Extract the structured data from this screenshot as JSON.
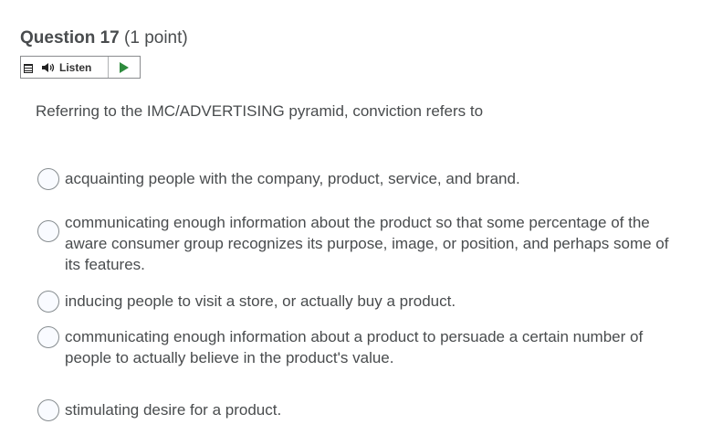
{
  "question": {
    "title": "Question 17",
    "points": "(1 point)",
    "text": "Referring to the IMC/ADVERTISING pyramid, conviction refers to"
  },
  "listen": {
    "menu_icon": "menu-icon",
    "speaker_icon": "speaker-icon",
    "label": "Listen",
    "play_icon": "play-icon",
    "accent_color": "#2e8b3d"
  },
  "options": [
    {
      "label": "acquainting people with the company, product, service, and brand.",
      "selected": false
    },
    {
      "label": "communicating enough information about the product so that some percentage of the aware consumer group recognizes its purpose, image, or position, and perhaps some of its features.",
      "selected": false
    },
    {
      "label": "inducing people to visit a store, or actually buy a product.",
      "selected": false
    },
    {
      "label": "communicating enough information about a product to persuade a certain number of people to actually believe in the product's value.",
      "selected": false
    },
    {
      "label": "stimulating desire for a product.",
      "selected": false
    }
  ]
}
